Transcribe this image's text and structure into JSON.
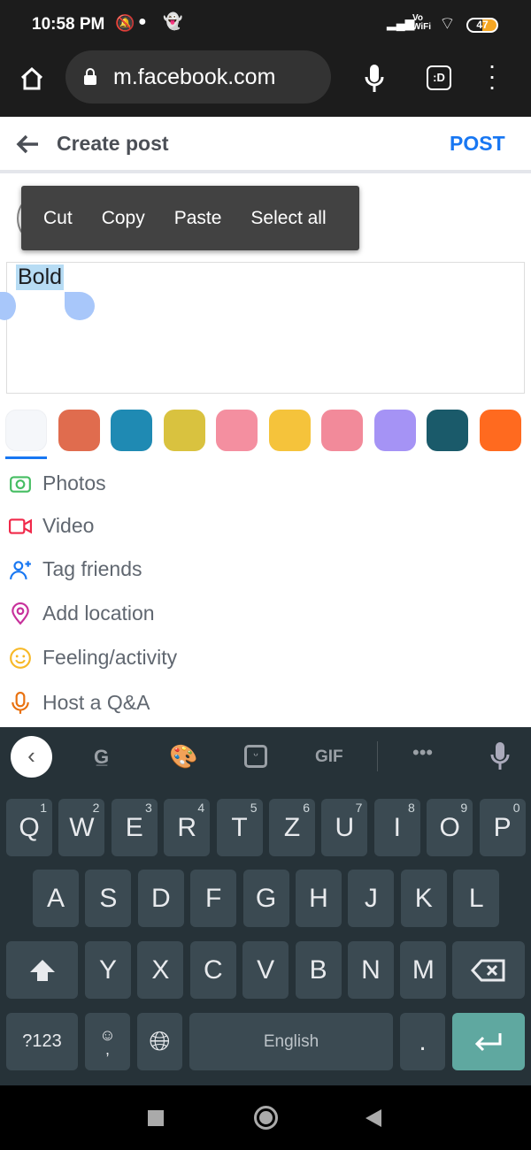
{
  "status": {
    "time": "10:58 PM",
    "battery": "47",
    "network": "Vo WiFi"
  },
  "browser": {
    "url": "m.facebook.com",
    "tab_icon": ":D"
  },
  "header": {
    "title": "Create post",
    "post_label": "POST",
    "accent": "#1877f2"
  },
  "context_menu": [
    "Cut",
    "Copy",
    "Paste",
    "Select all"
  ],
  "composer": {
    "text": "Bold"
  },
  "backgrounds": [
    "#f5f7fa",
    "#e06c4e",
    "#1f8ab3",
    "#d9c23f",
    "#f48fa0",
    "#f5c33b",
    "#f28a9a",
    "#a593f5",
    "#1a5a6a",
    "#ff6a1f"
  ],
  "options": [
    {
      "label": "Photos",
      "icon": "photo-icon",
      "color": "#45bd62"
    },
    {
      "label": "Video",
      "icon": "video-icon",
      "color": "#f02849"
    },
    {
      "label": "Tag friends",
      "icon": "tag-friends-icon",
      "color": "#1877f2"
    },
    {
      "label": "Add location",
      "icon": "location-icon",
      "color": "#c7309b"
    },
    {
      "label": "Feeling/activity",
      "icon": "feeling-icon",
      "color": "#f7b928"
    },
    {
      "label": "Host a Q&A",
      "icon": "mic-icon",
      "color": "#e9710f"
    }
  ],
  "keyboard": {
    "toolbar_gif": "GIF",
    "row1": [
      [
        "Q",
        "1"
      ],
      [
        "W",
        "2"
      ],
      [
        "E",
        "3"
      ],
      [
        "R",
        "4"
      ],
      [
        "T",
        "5"
      ],
      [
        "Z",
        "6"
      ],
      [
        "U",
        "7"
      ],
      [
        "I",
        "8"
      ],
      [
        "O",
        "9"
      ],
      [
        "P",
        "0"
      ]
    ],
    "row2": [
      "A",
      "S",
      "D",
      "F",
      "G",
      "H",
      "J",
      "K",
      "L"
    ],
    "row3": [
      "Y",
      "X",
      "C",
      "V",
      "B",
      "N",
      "M"
    ],
    "symbols": "?123",
    "comma": ",",
    "space": "English",
    "period": "."
  }
}
